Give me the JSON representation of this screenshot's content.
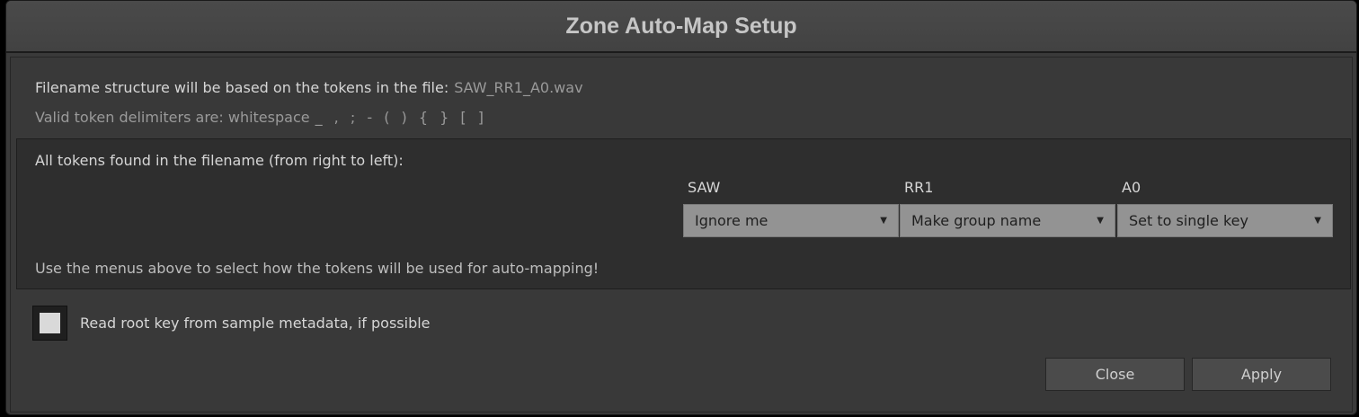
{
  "window": {
    "title": "Zone Auto-Map Setup"
  },
  "info": {
    "structure_text": "Filename structure will be based on the tokens in the file:",
    "filename": "SAW_RR1_A0.wav",
    "delimiters_text": "Valid token delimiters are: whitespace",
    "delimiters": "_ , ; - ( ) { } [ ]"
  },
  "tokens": {
    "heading": "All tokens found in the filename (from right to left):",
    "items": [
      {
        "label": "SAW",
        "selected": "Ignore me"
      },
      {
        "label": "RR1",
        "selected": "Make group name"
      },
      {
        "label": "A0",
        "selected": "Set to single key"
      }
    ],
    "hint": "Use the menus above to select how the tokens will be used for auto-mapping!"
  },
  "options": {
    "root_key_label": "Read root key from sample metadata, if possible",
    "root_key_checked": false
  },
  "buttons": {
    "close": "Close",
    "apply": "Apply"
  },
  "icons": {
    "dropdown": "triangle-down-icon"
  }
}
